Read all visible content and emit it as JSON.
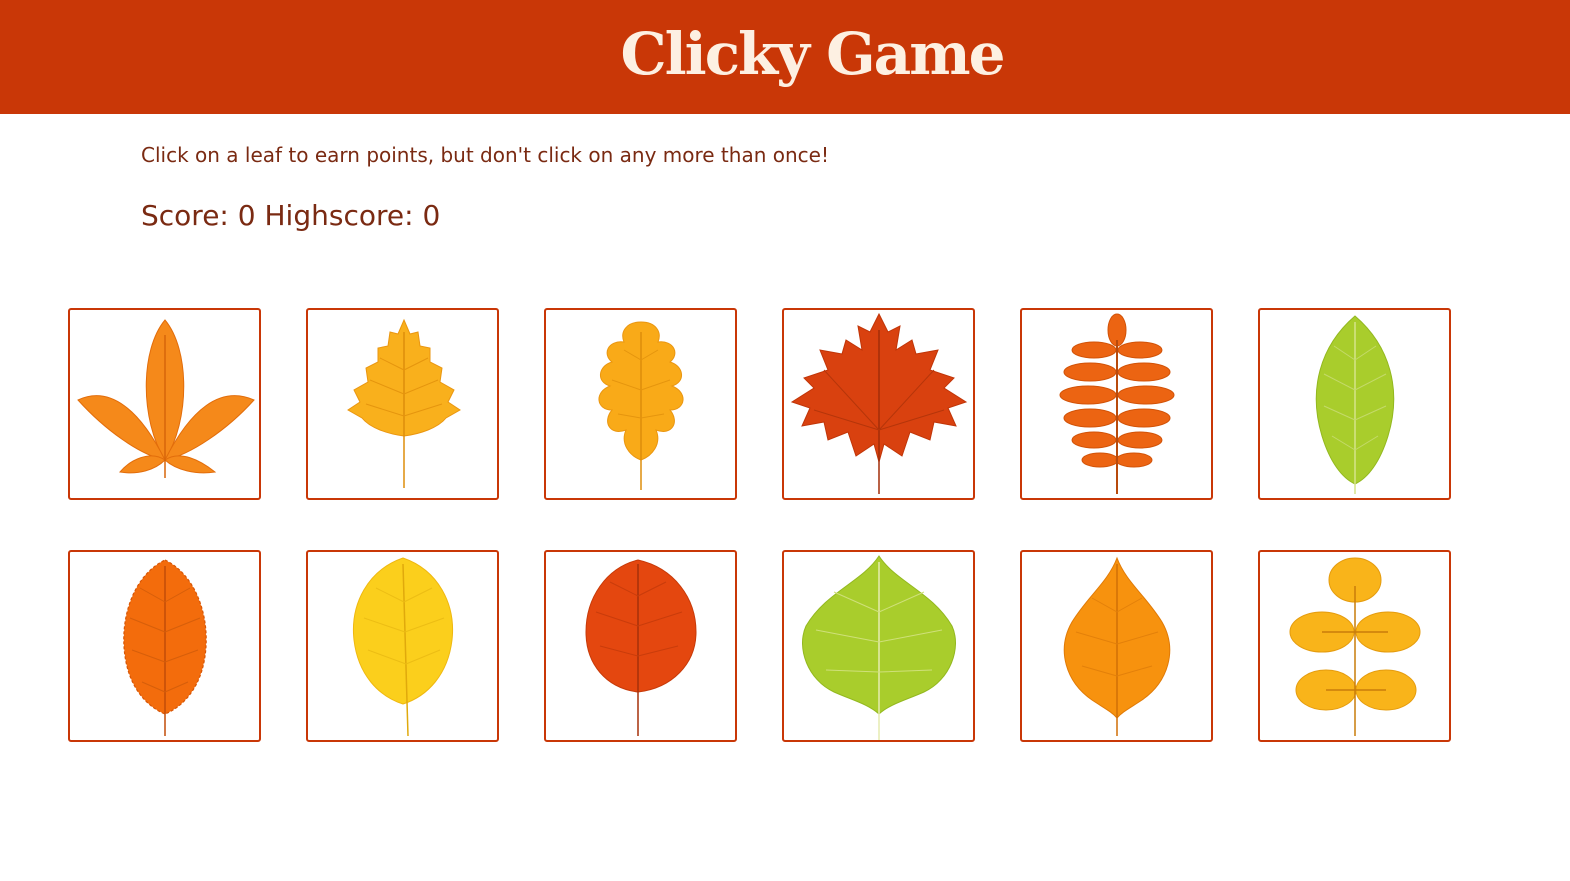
{
  "header": {
    "title": "Clicky Game"
  },
  "instructions": "Click on a leaf to earn points, but don't click on any more than once!",
  "score": {
    "label": "Score:",
    "value": "0",
    "highscore_label": "Highscore:",
    "highscore_value": "0"
  },
  "colors": {
    "brand": "#c93707",
    "title_text": "#fdf0e2",
    "body_text": "#7a2a12"
  },
  "cards": [
    {
      "leaf": "horse-chestnut-leaf-icon",
      "color": "#f5891a"
    },
    {
      "leaf": "birch-leaf-icon",
      "color": "#f9b01c"
    },
    {
      "leaf": "oak-leaf-icon",
      "color": "#f9aa18"
    },
    {
      "leaf": "maple-leaf-icon",
      "color": "#d9410f"
    },
    {
      "leaf": "rowan-leaf-icon",
      "color": "#ec6412"
    },
    {
      "leaf": "green-elliptic-leaf-icon",
      "color": "#a9cd2c"
    },
    {
      "leaf": "orange-serrated-leaf-icon",
      "color": "#f36c0c"
    },
    {
      "leaf": "yellow-round-leaf-icon",
      "color": "#fbcf1c"
    },
    {
      "leaf": "red-round-leaf-icon",
      "color": "#e4470f"
    },
    {
      "leaf": "green-heart-leaf-icon",
      "color": "#a9cd2c"
    },
    {
      "leaf": "orange-pointed-leaf-icon",
      "color": "#f7920e"
    },
    {
      "leaf": "ash-compound-leaf-icon",
      "color": "#f9b41a"
    }
  ]
}
